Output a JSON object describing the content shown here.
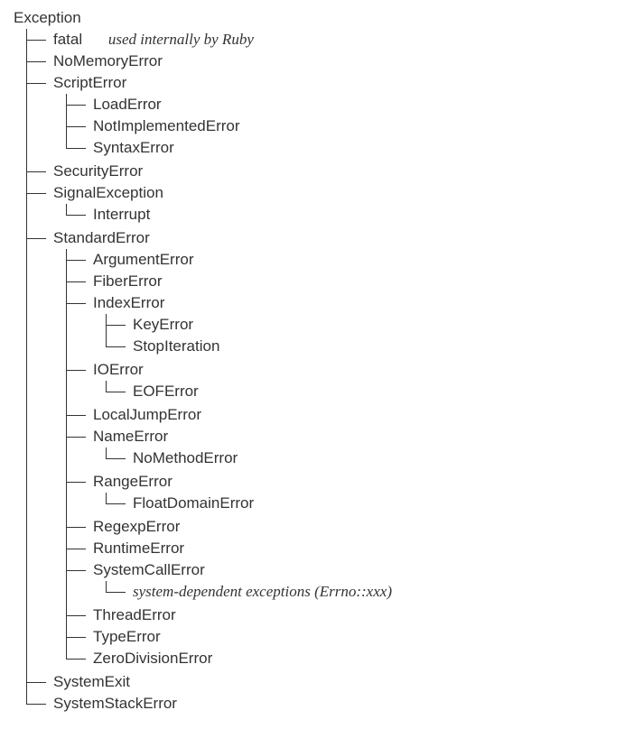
{
  "tree": {
    "root": "Exception",
    "nodes": {
      "fatal": {
        "label": "fatal",
        "note": "used internally by Ruby"
      },
      "nomem": {
        "label": "NoMemoryError"
      },
      "script": {
        "label": "ScriptError"
      },
      "loaderr": {
        "label": "LoadError"
      },
      "notimpl": {
        "label": "NotImplementedError"
      },
      "syntax": {
        "label": "SyntaxError"
      },
      "security": {
        "label": "SecurityError"
      },
      "signal": {
        "label": "SignalException"
      },
      "interrupt": {
        "label": "Interrupt"
      },
      "standard": {
        "label": "StandardError"
      },
      "argerr": {
        "label": "ArgumentError"
      },
      "fiber": {
        "label": "FiberError"
      },
      "index": {
        "label": "IndexError"
      },
      "keyerr": {
        "label": "KeyError"
      },
      "stopiter": {
        "label": "StopIteration"
      },
      "ioerr": {
        "label": "IOError"
      },
      "eof": {
        "label": "EOFError"
      },
      "localjump": {
        "label": "LocalJumpError"
      },
      "nameerr": {
        "label": "NameError"
      },
      "nomethod": {
        "label": "NoMethodError"
      },
      "range": {
        "label": "RangeError"
      },
      "floatdom": {
        "label": "FloatDomainError"
      },
      "regexp": {
        "label": "RegexpError"
      },
      "runtime": {
        "label": "RuntimeError"
      },
      "syscall": {
        "label": "SystemCallError"
      },
      "errno": {
        "label": "system-dependent exceptions (Errno::xxx)",
        "italic": true
      },
      "thread": {
        "label": "ThreadError"
      },
      "typeerr": {
        "label": "TypeError"
      },
      "zerodiv": {
        "label": "ZeroDivisionError"
      },
      "sysexit": {
        "label": "SystemExit"
      },
      "sysstack": {
        "label": "SystemStackError"
      }
    }
  }
}
